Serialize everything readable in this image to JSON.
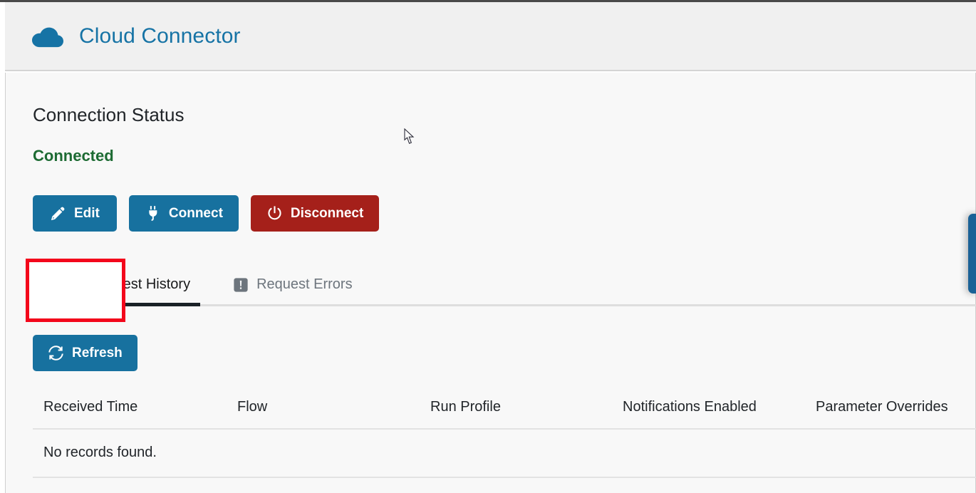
{
  "header": {
    "title": "Cloud Connector",
    "logo_icon": "cloud-icon",
    "title_color": "#1673a5"
  },
  "connection": {
    "section_title": "Connection Status",
    "status": "Connected",
    "status_color": "#1d6b33"
  },
  "actions": {
    "edit": {
      "label": "Edit",
      "icon": "pencil-icon",
      "color": "#17719f"
    },
    "connect": {
      "label": "Connect",
      "icon": "plug-icon",
      "color": "#17719f"
    },
    "disconnect": {
      "label": "Disconnect",
      "icon": "power-icon",
      "color": "#a5201a"
    }
  },
  "annotation": {
    "target": "edit-button",
    "color": "#f3071b"
  },
  "tabs": [
    {
      "label": "Job Request History",
      "icon": "list-check-icon",
      "active": true
    },
    {
      "label": "Request Errors",
      "icon": "exclamation-square-icon",
      "active": false
    }
  ],
  "toolbar": {
    "refresh_label": "Refresh",
    "refresh_icon": "sync-icon"
  },
  "table": {
    "columns": [
      "Received Time",
      "Flow",
      "Run Profile",
      "Notifications Enabled",
      "Parameter Overrides"
    ],
    "rows": [],
    "empty_message": "No records found."
  },
  "side_tab": {
    "name": "side-panel-handle",
    "color": "#1a6196"
  }
}
